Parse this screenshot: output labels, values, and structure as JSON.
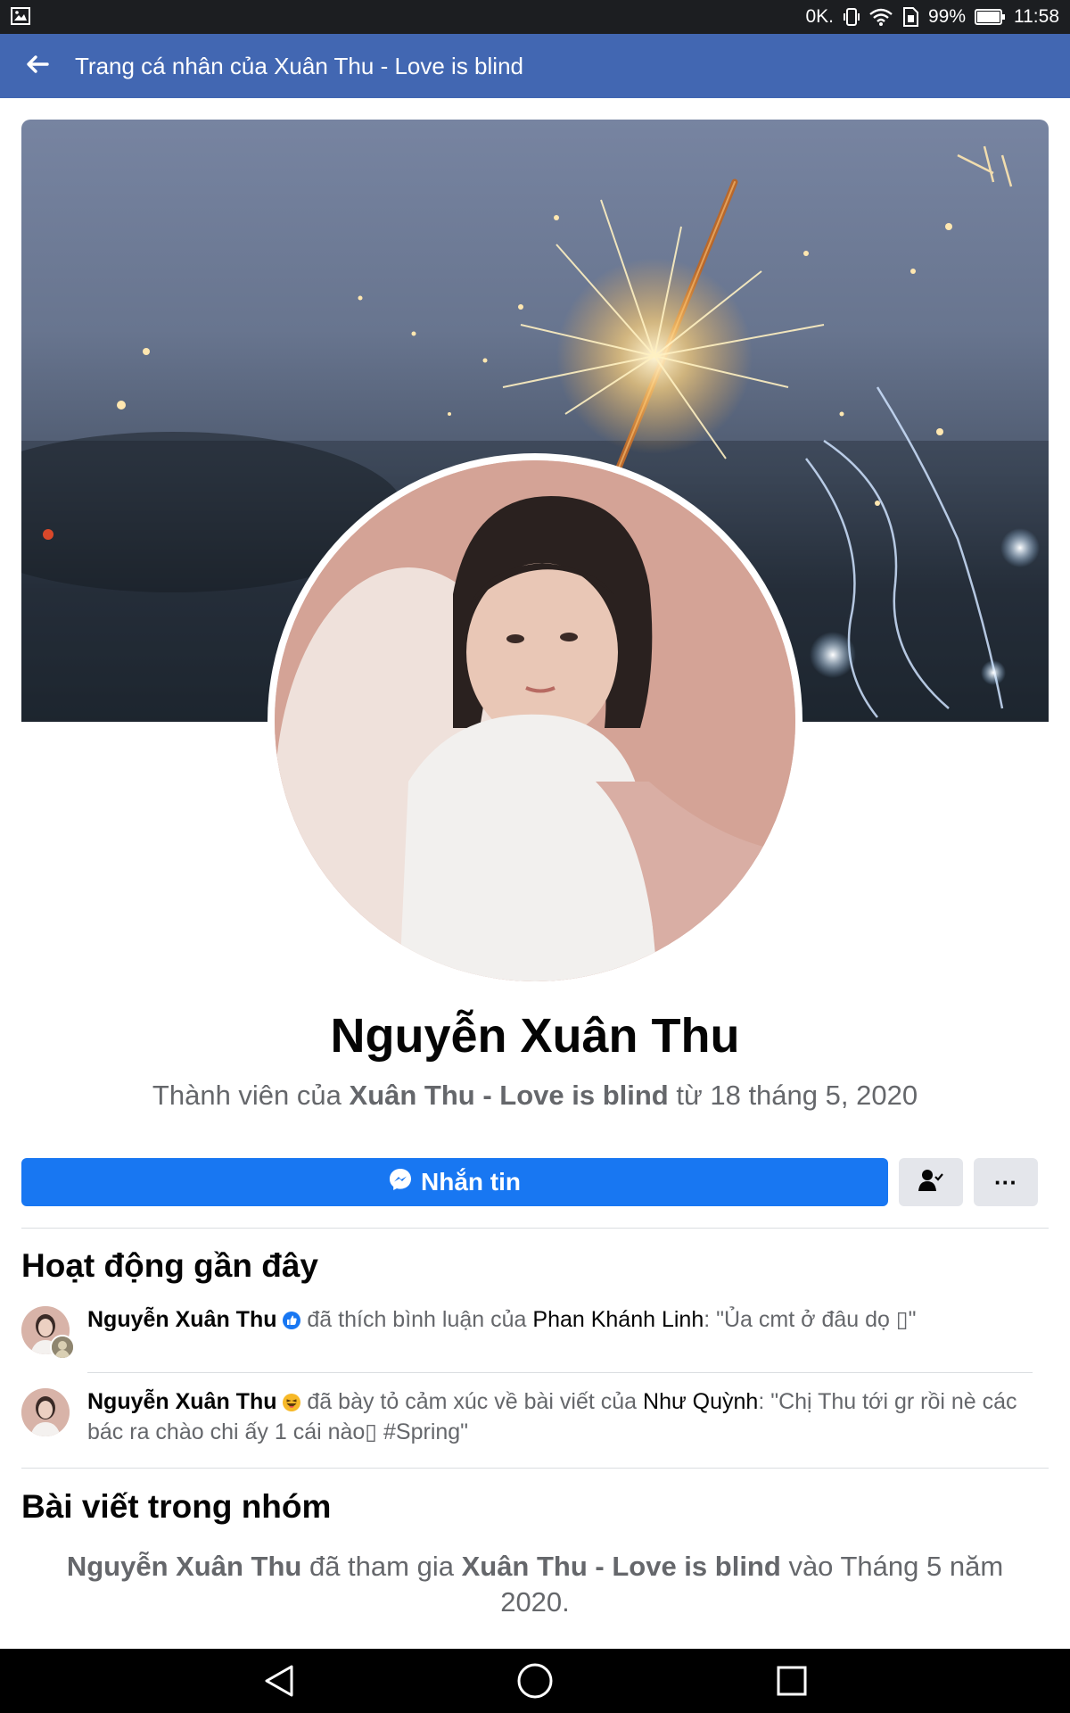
{
  "status_bar": {
    "speed": "0K.",
    "battery_percent": "99%",
    "time": "11:58",
    "icons": [
      "gallery-icon",
      "vibrate-icon",
      "wifi-icon",
      "sim-icon",
      "battery-icon"
    ]
  },
  "app_bar": {
    "back_icon": "arrow-left-icon",
    "title": "Trang cá nhân của Xuân Thu - Love is blind",
    "background": "#4267b2"
  },
  "profile": {
    "name": "Nguyễn Xuân Thu",
    "member_prefix": "Thành viên của",
    "group_name": "Xuân Thu - Love is blind",
    "member_since": "từ 18 tháng 5, 2020"
  },
  "actions": {
    "message_label": "Nhắn tin",
    "message_icon": "messenger-icon",
    "friend_icon": "friend-check-icon",
    "more_label": "···",
    "accent": "#1877f2"
  },
  "recent_activity": {
    "title": "Hoạt động gần đây",
    "items": [
      {
        "actor": "Nguyễn Xuân Thu",
        "reaction_icon": "like-icon",
        "action": "đã thích bình luận của",
        "target": "Phan Khánh Linh",
        "quote": ": \"Ủa cmt ở đâu dọ ▯\""
      },
      {
        "actor": "Nguyễn Xuân Thu",
        "reaction_icon": "haha-icon",
        "action": "đã bày tỏ cảm xúc về bài viết của",
        "target": "Như Quỳnh",
        "quote": ": \"Chị Thu tới gr rồi nè các bác ra chào chi ấy 1 cái nào▯ #Spring\""
      }
    ]
  },
  "group_posts": {
    "title": "Bài viết trong nhóm",
    "actor": "Nguyễn Xuân Thu",
    "joined_text": "đã tham gia",
    "group_name": "Xuân Thu - Love is blind",
    "when": "vào Tháng 5 năm 2020."
  },
  "nav_bar": {
    "icons": [
      "nav-back-icon",
      "nav-home-icon",
      "nav-recents-icon"
    ]
  }
}
